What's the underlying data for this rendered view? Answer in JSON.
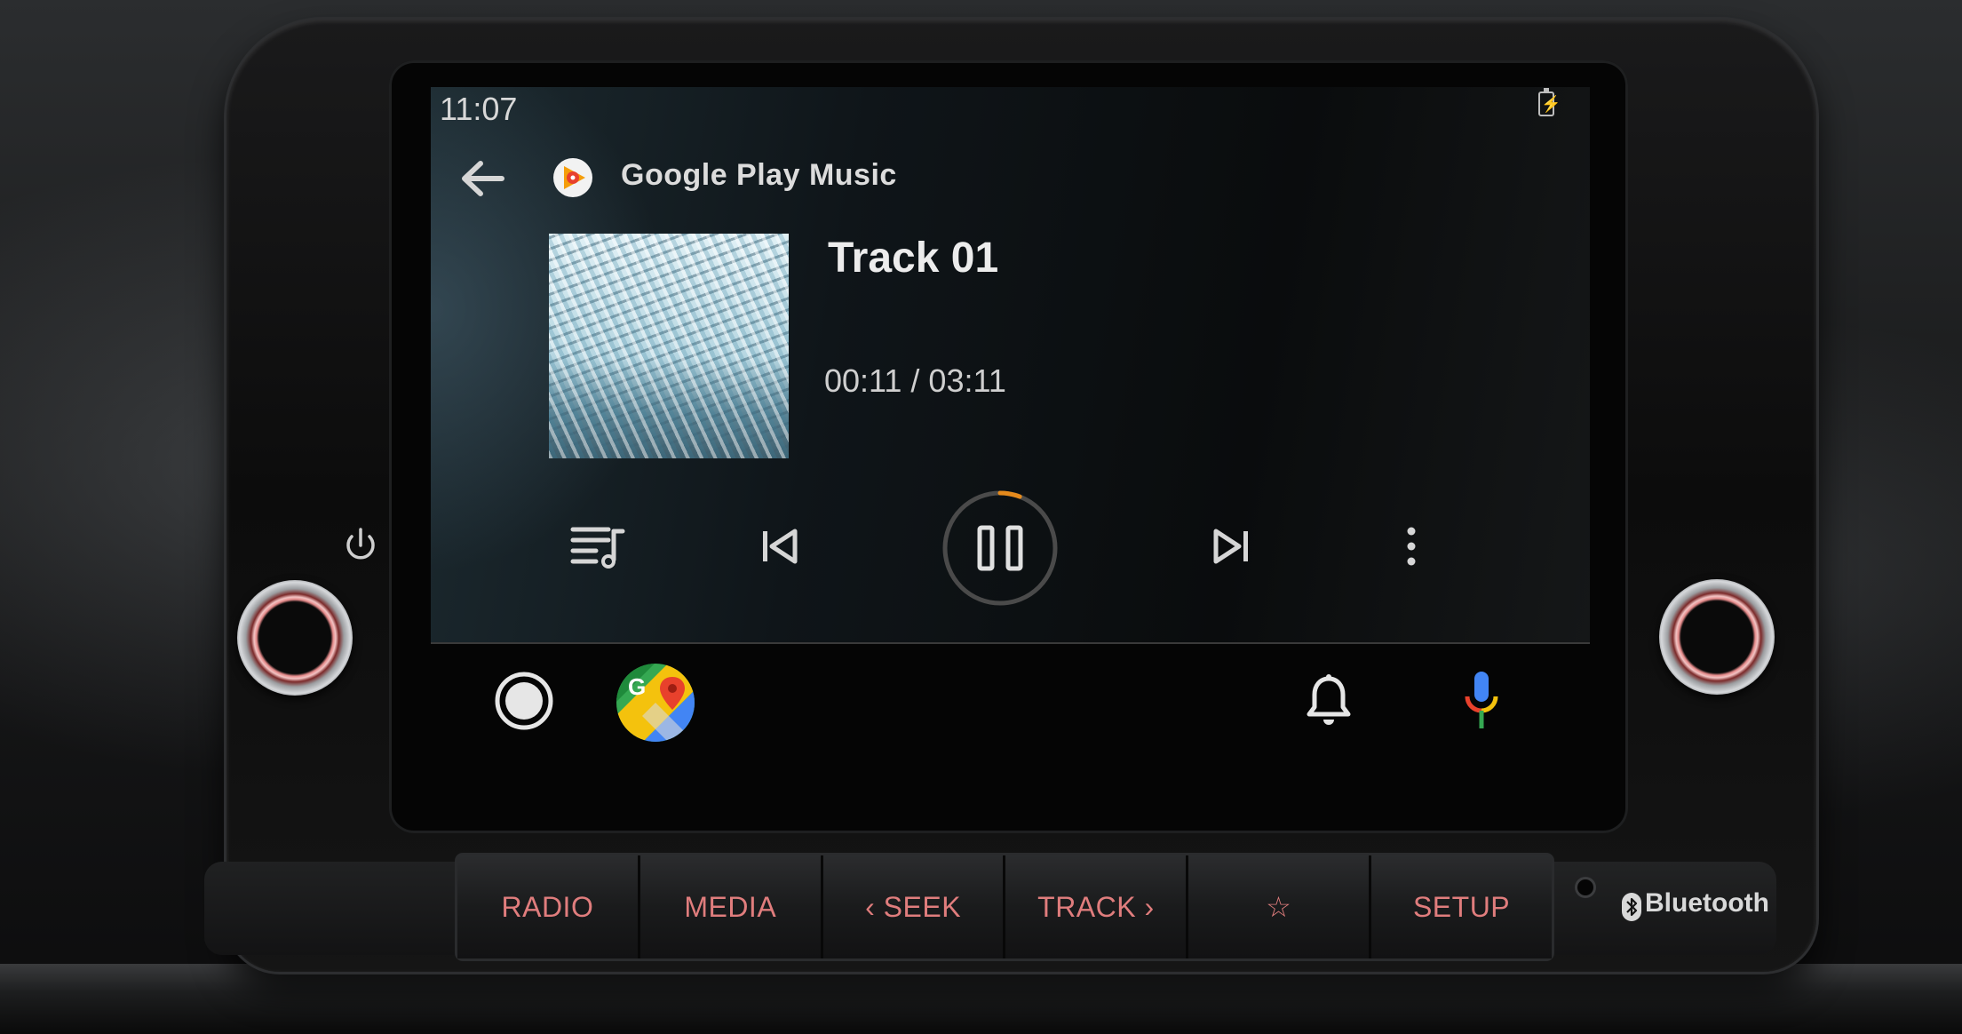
{
  "status_bar": {
    "time": "11:07",
    "battery_icon": "battery-charging-icon"
  },
  "header": {
    "back_icon": "arrow-back-icon",
    "app_logo": "google-play-music-logo",
    "app_name": "Google Play Music"
  },
  "now_playing": {
    "track_title": "Track 01",
    "time_display": "00:11 / 03:11",
    "progress": 0.058
  },
  "controls": {
    "queue_icon": "playlist-icon",
    "previous_icon": "skip-previous-icon",
    "play_state_icon": "pause-icon",
    "next_icon": "skip-next-icon",
    "menu_icon": "more-vert-icon"
  },
  "nav_bar": {
    "home_icon": "home-circle-icon",
    "maps_icon": "google-maps-icon",
    "notifications_icon": "bell-icon",
    "voice_icon": "microphone-icon"
  },
  "hardware_buttons": [
    {
      "label": "RADIO"
    },
    {
      "label": "MEDIA"
    },
    {
      "label": "‹ SEEK"
    },
    {
      "label": "TRACK ›"
    },
    {
      "label": "☆"
    },
    {
      "label": "SETUP"
    }
  ],
  "hardware": {
    "bluetooth_label": "Bluetooth",
    "power_icon": "power-icon"
  },
  "colors": {
    "button_text": "#e07d7d",
    "progress_ring": "#e58a1c",
    "screen_text": "#dcdcdc"
  }
}
